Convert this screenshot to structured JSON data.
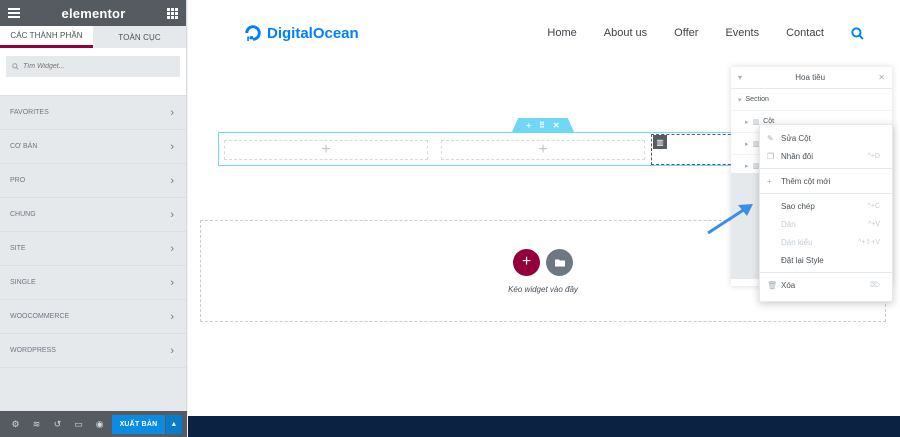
{
  "sidebar": {
    "logo": "elementor",
    "tabs": [
      "CÁC THÀNH PHẦN",
      "TOÀN CỤC"
    ],
    "search_placeholder": "Tìm Widget...",
    "categories": [
      "FAVORITES",
      "CƠ BẢN",
      "PRO",
      "CHUNG",
      "SITE",
      "SINGLE",
      "WOOCOMMERCE",
      "WORDPRESS"
    ],
    "publish_label": "XUẤT BẢN"
  },
  "site": {
    "brand": "DigitalOcean",
    "nav": [
      "Home",
      "About us",
      "Offer",
      "Events",
      "Contact"
    ],
    "brand_color": "#0080ff"
  },
  "canvas": {
    "drop_text": "Kéo widget vào đây",
    "add_button_color": "#93003c",
    "folder_button_color": "#6d7882",
    "section_outline_color": "#71d7f7"
  },
  "navigator": {
    "title": "Hoa tiêu",
    "section_label": "Section",
    "column_label": "Cột"
  },
  "context_menu": {
    "items": [
      {
        "label": "Sửa Cột",
        "shortcut": "",
        "icon": "pencil-icon",
        "disabled": false
      },
      {
        "label": "Nhân đôi",
        "shortcut": "^+D",
        "icon": "duplicate-icon",
        "disabled": false
      },
      {
        "label": "Thêm cột mới",
        "shortcut": "",
        "icon": "plus-icon",
        "disabled": false
      },
      {
        "label": "Sao chép",
        "shortcut": "^+C",
        "icon": "",
        "disabled": false
      },
      {
        "label": "Dán",
        "shortcut": "^+V",
        "icon": "",
        "disabled": true
      },
      {
        "label": "Dán kiểu",
        "shortcut": "^+⇧+V",
        "icon": "",
        "disabled": true
      },
      {
        "label": "Đặt lại Style",
        "shortcut": "",
        "icon": "",
        "disabled": false
      },
      {
        "label": "Xóa",
        "shortcut": "⌦",
        "icon": "trash-icon",
        "disabled": false
      }
    ]
  }
}
